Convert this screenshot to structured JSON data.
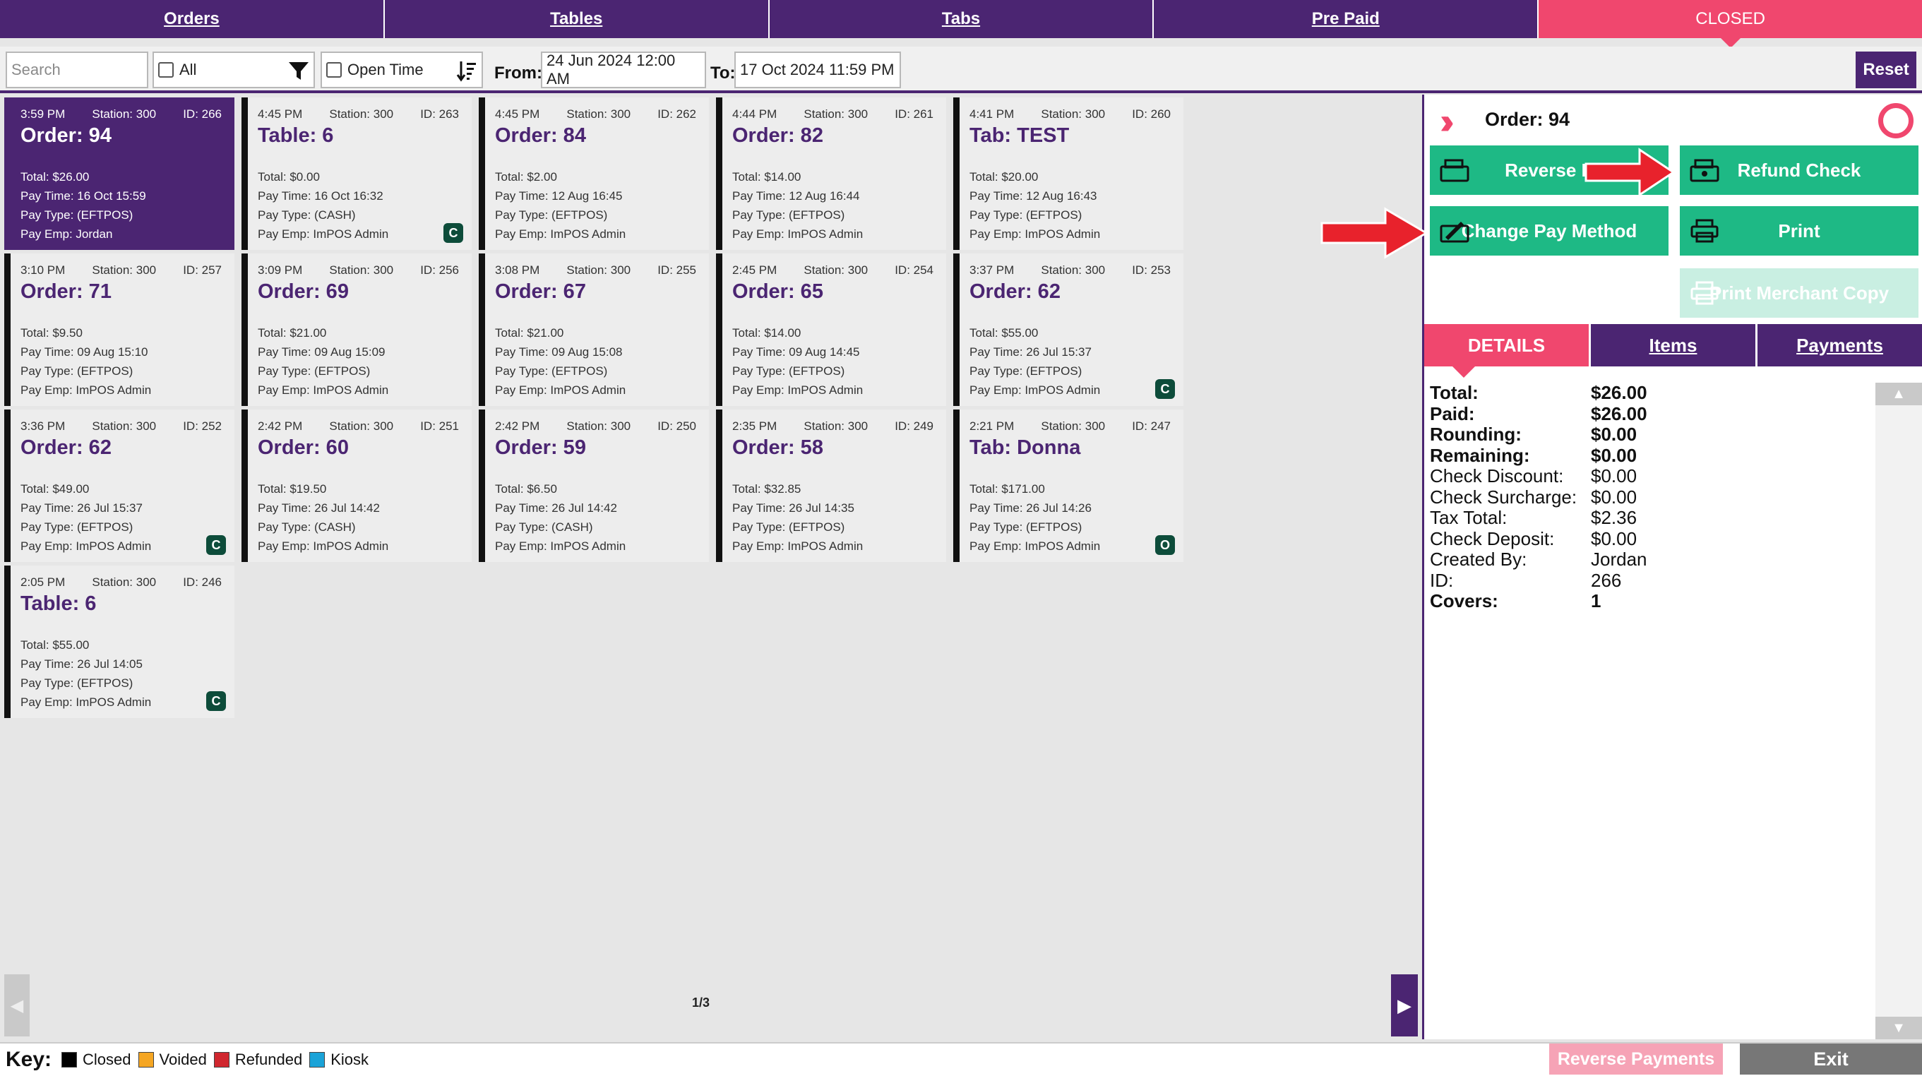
{
  "nav": {
    "tabs": [
      {
        "label": "Orders"
      },
      {
        "label": "Tables"
      },
      {
        "label": "Tabs"
      },
      {
        "label": "Pre Paid"
      },
      {
        "label": "CLOSED"
      }
    ]
  },
  "filters": {
    "search_placeholder": "Search",
    "all_label": "All",
    "open_time_label": "Open Time",
    "from_label": "From:",
    "from_value": "24 Jun 2024 12:00 AM",
    "to_label": "To:",
    "to_value": "17 Oct 2024 11:59 PM",
    "reset_label": "Reset"
  },
  "cards": [
    {
      "time": "3:59 PM",
      "station": "Station: 300",
      "id": "ID: 266",
      "title": "Order: 94",
      "total": "Total: $26.00",
      "pay_time": "Pay Time: 16 Oct 15:59",
      "pay_type": "Pay Type: (EFTPOS)",
      "pay_emp": "Pay Emp: Jordan",
      "badge": ""
    },
    {
      "time": "4:45 PM",
      "station": "Station: 300",
      "id": "ID: 263",
      "title": "Table: 6",
      "total": "Total: $0.00",
      "pay_time": "Pay Time: 16 Oct 16:32",
      "pay_type": "Pay Type: (CASH)",
      "pay_emp": "Pay Emp: ImPOS Admin",
      "badge": "C"
    },
    {
      "time": "4:45 PM",
      "station": "Station: 300",
      "id": "ID: 262",
      "title": "Order: 84",
      "total": "Total: $2.00",
      "pay_time": "Pay Time: 12 Aug 16:45",
      "pay_type": "Pay Type: (EFTPOS)",
      "pay_emp": "Pay Emp: ImPOS Admin",
      "badge": ""
    },
    {
      "time": "4:44 PM",
      "station": "Station: 300",
      "id": "ID: 261",
      "title": "Order: 82",
      "total": "Total: $14.00",
      "pay_time": "Pay Time: 12 Aug 16:44",
      "pay_type": "Pay Type: (EFTPOS)",
      "pay_emp": "Pay Emp: ImPOS Admin",
      "badge": ""
    },
    {
      "time": "4:41 PM",
      "station": "Station: 300",
      "id": "ID: 260",
      "title": "Tab: TEST",
      "total": "Total: $20.00",
      "pay_time": "Pay Time: 12 Aug 16:43",
      "pay_type": "Pay Type: (EFTPOS)",
      "pay_emp": "Pay Emp: ImPOS Admin",
      "badge": ""
    },
    {
      "time": "3:10 PM",
      "station": "Station: 300",
      "id": "ID: 257",
      "title": "Order: 71",
      "total": "Total: $9.50",
      "pay_time": "Pay Time: 09 Aug 15:10",
      "pay_type": "Pay Type: (EFTPOS)",
      "pay_emp": "Pay Emp: ImPOS Admin",
      "badge": ""
    },
    {
      "time": "3:09 PM",
      "station": "Station: 300",
      "id": "ID: 256",
      "title": "Order: 69",
      "total": "Total: $21.00",
      "pay_time": "Pay Time: 09 Aug 15:09",
      "pay_type": "Pay Type: (EFTPOS)",
      "pay_emp": "Pay Emp: ImPOS Admin",
      "badge": ""
    },
    {
      "time": "3:08 PM",
      "station": "Station: 300",
      "id": "ID: 255",
      "title": "Order: 67",
      "total": "Total: $21.00",
      "pay_time": "Pay Time: 09 Aug 15:08",
      "pay_type": "Pay Type: (EFTPOS)",
      "pay_emp": "Pay Emp: ImPOS Admin",
      "badge": ""
    },
    {
      "time": "2:45 PM",
      "station": "Station: 300",
      "id": "ID: 254",
      "title": "Order: 65",
      "total": "Total: $14.00",
      "pay_time": "Pay Time: 09 Aug 14:45",
      "pay_type": "Pay Type: (EFTPOS)",
      "pay_emp": "Pay Emp: ImPOS Admin",
      "badge": ""
    },
    {
      "time": "3:37 PM",
      "station": "Station: 300",
      "id": "ID: 253",
      "title": "Order: 62",
      "total": "Total: $55.00",
      "pay_time": "Pay Time: 26 Jul 15:37",
      "pay_type": "Pay Type: (EFTPOS)",
      "pay_emp": "Pay Emp: ImPOS Admin",
      "badge": "C"
    },
    {
      "time": "3:36 PM",
      "station": "Station: 300",
      "id": "ID: 252",
      "title": "Order: 62",
      "total": "Total: $49.00",
      "pay_time": "Pay Time: 26 Jul 15:37",
      "pay_type": "Pay Type: (EFTPOS)",
      "pay_emp": "Pay Emp: ImPOS Admin",
      "badge": "C"
    },
    {
      "time": "2:42 PM",
      "station": "Station: 300",
      "id": "ID: 251",
      "title": "Order: 60",
      "total": "Total: $19.50",
      "pay_time": "Pay Time: 26 Jul 14:42",
      "pay_type": "Pay Type: (CASH)",
      "pay_emp": "Pay Emp: ImPOS Admin",
      "badge": ""
    },
    {
      "time": "2:42 PM",
      "station": "Station: 300",
      "id": "ID: 250",
      "title": "Order: 59",
      "total": "Total: $6.50",
      "pay_time": "Pay Time: 26 Jul 14:42",
      "pay_type": "Pay Type: (CASH)",
      "pay_emp": "Pay Emp: ImPOS Admin",
      "badge": ""
    },
    {
      "time": "2:35 PM",
      "station": "Station: 300",
      "id": "ID: 249",
      "title": "Order: 58",
      "total": "Total: $32.85",
      "pay_time": "Pay Time: 26 Jul 14:35",
      "pay_type": "Pay Type: (EFTPOS)",
      "pay_emp": "Pay Emp: ImPOS Admin",
      "badge": ""
    },
    {
      "time": "2:21 PM",
      "station": "Station: 300",
      "id": "ID: 247",
      "title": "Tab: Donna",
      "total": "Total: $171.00",
      "pay_time": "Pay Time: 26 Jul 14:26",
      "pay_type": "Pay Type: (EFTPOS)",
      "pay_emp": "Pay Emp: ImPOS Admin",
      "badge": "O"
    },
    {
      "time": "2:05 PM",
      "station": "Station: 300",
      "id": "ID: 246",
      "title": "Table: 6",
      "total": "Total: $55.00",
      "pay_time": "Pay Time: 26 Jul 14:05",
      "pay_type": "Pay Type: (EFTPOS)",
      "pay_emp": "Pay Emp: ImPOS Admin",
      "badge": "C"
    }
  ],
  "pager": {
    "page_info": "1/3"
  },
  "panel": {
    "order_title": "Order: 94",
    "buttons": {
      "reverse_payment": "Reverse P",
      "refund_check": "Refund Check",
      "change_pay_method": "Change Pay Method",
      "print": "Print",
      "print_merchant_copy": "Print Merchant Copy"
    },
    "tabs": [
      {
        "label": "DETAILS"
      },
      {
        "label": "Items"
      },
      {
        "label": "Payments"
      }
    ],
    "details": [
      {
        "k": "Total:",
        "v": "$26.00",
        "bold": true
      },
      {
        "k": "Paid:",
        "v": "$26.00",
        "bold": true
      },
      {
        "k": "Rounding:",
        "v": "$0.00",
        "bold": true
      },
      {
        "k": "Remaining:",
        "v": "$0.00",
        "bold": true
      },
      {
        "k": "Check Discount:",
        "v": "$0.00",
        "bold": false
      },
      {
        "k": "Check Surcharge:",
        "v": "$0.00",
        "bold": false
      },
      {
        "k": "Tax Total:",
        "v": "$2.36",
        "bold": false
      },
      {
        "k": "Check Deposit:",
        "v": "$0.00",
        "bold": false
      },
      {
        "k": "Created By:",
        "v": "Jordan",
        "bold": false
      },
      {
        "k": "ID:",
        "v": "266",
        "bold": false
      },
      {
        "k": "Covers:",
        "v": "1",
        "bold": true
      }
    ]
  },
  "key": {
    "title": "Key:",
    "items": [
      {
        "label": "Closed",
        "color": "#000000"
      },
      {
        "label": "Voided",
        "color": "#f5a623"
      },
      {
        "label": "Refunded",
        "color": "#d0272f"
      },
      {
        "label": "Kiosk",
        "color": "#1aa3d8"
      }
    ]
  },
  "footer": {
    "reverse_payments": "Reverse Payments",
    "exit": "Exit"
  },
  "colors": {
    "purple": "#4b2572",
    "pink": "#f0476e",
    "green": "#1eb985",
    "arrow_red": "#e8222c"
  }
}
